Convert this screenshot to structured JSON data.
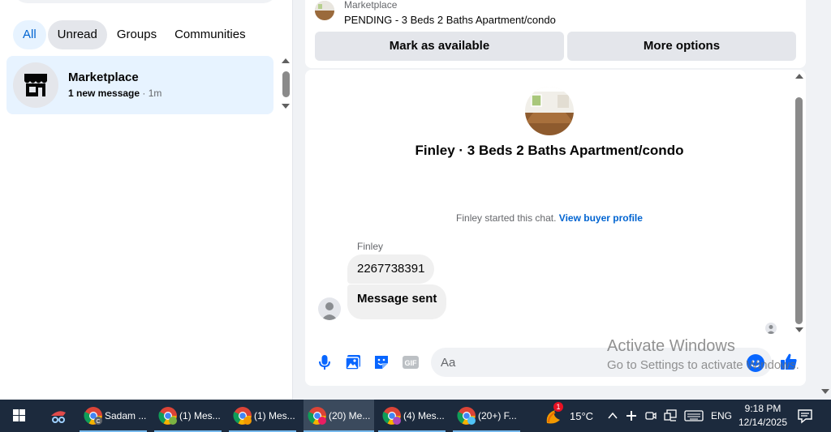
{
  "filters": {
    "all": "All",
    "unread": "Unread",
    "groups": "Groups",
    "communities": "Communities"
  },
  "conversation": {
    "title": "Marketplace",
    "new_count": "1 new message",
    "time": " · 1m",
    "icon": "storefront-icon"
  },
  "listing": {
    "label": "Marketplace",
    "status": "PENDING - 3 Beds 2 Baths Apartment/condo",
    "mark_available": "Mark as available",
    "more_options": "More options"
  },
  "chat": {
    "title": "Finley · 3 Beds 2 Baths Apartment/condo",
    "started": "Finley started this chat. ",
    "profile_link": "View buyer profile",
    "sender": "Finley",
    "messages": [
      "2267738391",
      "Message sent"
    ]
  },
  "composer": {
    "placeholder": "Aa",
    "icons": [
      "microphone-icon",
      "photo-icon",
      "sticker-icon",
      "gif-icon",
      "emoji-icon",
      "thumbs-up-icon"
    ]
  },
  "watermark": {
    "line1": "Activate Windows",
    "line2": "Go to Settings to activate Windows."
  },
  "taskbar": {
    "items": [
      "Sadam ...",
      "(1) Mes...",
      "(1) Mes...",
      "(20) Me...",
      "(4) Mes...",
      "(20+) F..."
    ],
    "weather_badge": "1",
    "temperature": "15°C",
    "language": "ENG",
    "time": "9:18 PM",
    "date": "12/14/2025"
  },
  "colors": {
    "accent": "#0064d1",
    "messenger_blue": "#0866ff",
    "taskbar": "#1c2a3d"
  }
}
